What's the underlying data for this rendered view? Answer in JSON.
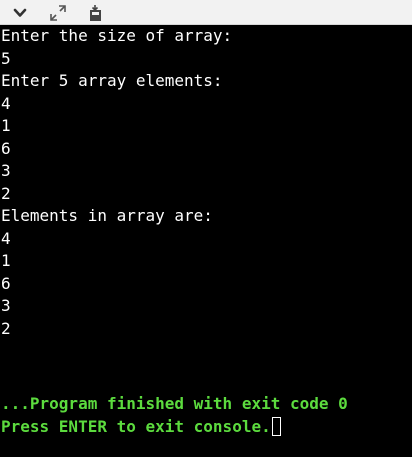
{
  "toolbar": {
    "icons": [
      "chevron-down-icon",
      "expand-icon",
      "download-icon"
    ]
  },
  "console": {
    "lines": [
      "Enter the size of array:",
      "5",
      "Enter 5 array elements:",
      "4",
      "1",
      "6",
      "3",
      "2",
      "Elements in array are:",
      "4",
      "1",
      "6",
      "3",
      "2"
    ],
    "exit_message": "...Program finished with exit code 0",
    "prompt_message": "Press ENTER to exit console."
  },
  "colors": {
    "background": "#000000",
    "text": "#ffffff",
    "success": "#5cdb3e",
    "toolbar": "#f2f2f2"
  }
}
